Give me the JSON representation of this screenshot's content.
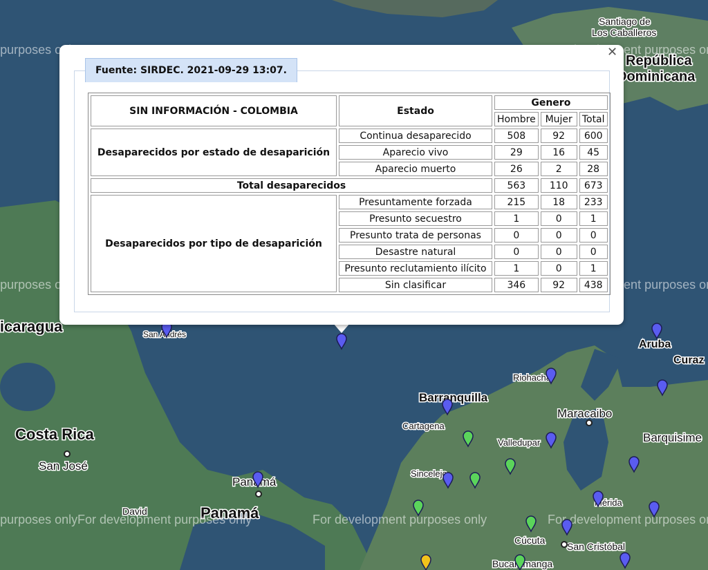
{
  "map": {
    "labels": {
      "santiago": "Santiago de",
      "caballeros": "Los Caballeros",
      "republica": "República",
      "dominicana": "Dominicana",
      "nicaragua": "Nicaragua",
      "san_andres": "San Andrés",
      "aruba": "Aruba",
      "curazao": "Curaz",
      "riohacha": "Riohacha",
      "barranquilla": "Barranquilla",
      "maracaibo": "Maracaibo",
      "cartagena": "Cartagena",
      "valledupar": "Valledupar",
      "barquisimeto": "Barquisime",
      "costa_rica": "Costa Rica",
      "san_jose": "San José",
      "panama_city": "Panamá",
      "panama": "Panamá",
      "david": "David",
      "sincelejo": "Sincelejo",
      "merida": "Mérida",
      "cucuta": "Cúcuta",
      "san_cristobal": "San Cristóbal",
      "bucaramanga": "Bucaramanga"
    },
    "watermark": "For development purposes only",
    "marker_colors": {
      "blue": "#5a5cf0",
      "green": "#5bd45b",
      "yellow": "#f2c21b"
    }
  },
  "popup": {
    "source_tab": "Fuente: SIRDEC. 2021-09-29 13:07.",
    "close_icon": "close-icon",
    "table": {
      "title": "SIN INFORMACIÓN - COLOMBIA",
      "estado_header": "Estado",
      "genero_header": "Genero",
      "col_hombre": "Hombre",
      "col_mujer": "Mujer",
      "col_total": "Total",
      "group1": {
        "label": "Desaparecidos por estado de desaparición",
        "rows": [
          {
            "estado": "Continua desaparecido",
            "hombre": "508",
            "mujer": "92",
            "total": "600"
          },
          {
            "estado": "Aparecio vivo",
            "hombre": "29",
            "mujer": "16",
            "total": "45"
          },
          {
            "estado": "Aparecio muerto",
            "hombre": "26",
            "mujer": "2",
            "total": "28"
          }
        ]
      },
      "total_row": {
        "label": "Total desaparecidos",
        "hombre": "563",
        "mujer": "110",
        "total": "673"
      },
      "group2": {
        "label": "Desaparecidos por tipo de desaparición",
        "rows": [
          {
            "estado": "Presuntamente forzada",
            "hombre": "215",
            "mujer": "18",
            "total": "233"
          },
          {
            "estado": "Presunto secuestro",
            "hombre": "1",
            "mujer": "0",
            "total": "1"
          },
          {
            "estado": "Presunto trata de personas",
            "hombre": "0",
            "mujer": "0",
            "total": "0"
          },
          {
            "estado": "Desastre natural",
            "hombre": "0",
            "mujer": "0",
            "total": "0"
          },
          {
            "estado": "Presunto reclutamiento ilícito",
            "hombre": "1",
            "mujer": "0",
            "total": "1"
          },
          {
            "estado": "Sin clasificar",
            "hombre": "346",
            "mujer": "92",
            "total": "438"
          }
        ]
      }
    }
  }
}
